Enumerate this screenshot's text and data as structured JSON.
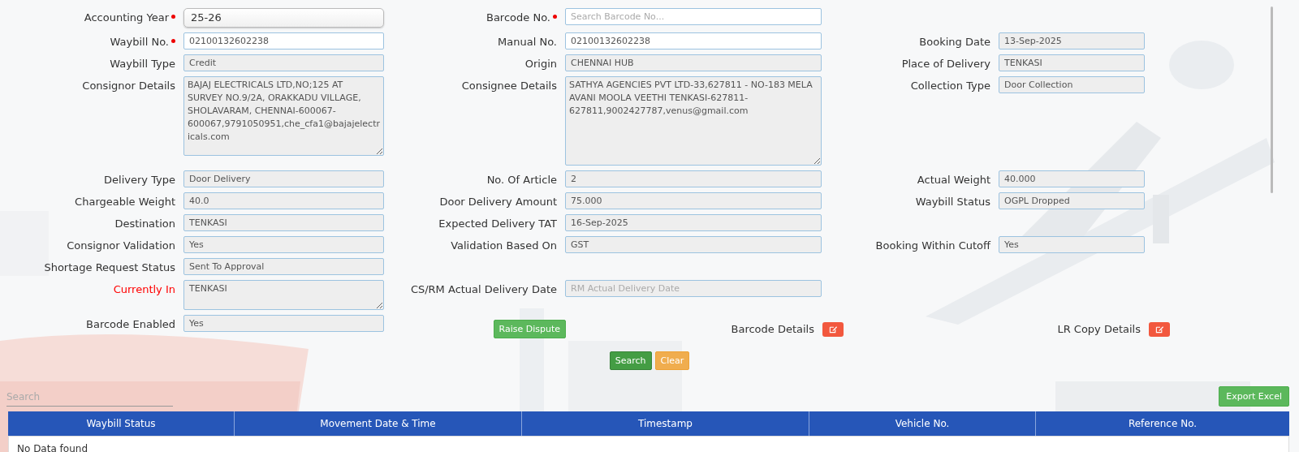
{
  "form_rows": [
    {
      "left": {
        "label": "Accounting Year",
        "required": true,
        "kind": "select",
        "value": "25-26"
      },
      "middle": {
        "label": "Barcode No.",
        "required": true,
        "kind": "input",
        "placeholder": "Search Barcode No..."
      }
    },
    {
      "left": {
        "label": "Waybill No.",
        "required": true,
        "kind": "input",
        "value": "02100132602238"
      },
      "middle": {
        "label": "Manual No.",
        "kind": "input",
        "value": "02100132602238"
      },
      "right": {
        "label": "Booking Date",
        "kind": "readonly",
        "value": "13-Sep-2025"
      }
    },
    {
      "left": {
        "label": "Waybill Type",
        "kind": "readonly",
        "value": "Credit"
      },
      "middle": {
        "label": "Origin",
        "kind": "readonly",
        "value": "CHENNAI HUB"
      },
      "right": {
        "label": "Place of Delivery",
        "kind": "readonly",
        "value": "TENKASI"
      }
    },
    {
      "left": {
        "label": "Consignor Details",
        "kind": "textarea",
        "value": "BAJAJ ELECTRICALS LTD,NO;125 AT SURVEY NO.9/2A, ORAKKADU VILLAGE, SHOLAVARAM, CHENNAI-600067-600067,9791050951,che_cfa1@bajajelectricals.com"
      },
      "middle": {
        "label": "Consignee Details",
        "kind": "textarea",
        "value": "SATHYA AGENCIES PVT LTD-33,627811 - NO-183 MELA AVANI MOOLA VEETHI TENKASI-627811-627811,9002427787,venus@gmail.com"
      },
      "right": {
        "label": "Collection Type",
        "kind": "readonly",
        "value": "Door Collection"
      }
    },
    {
      "left": {
        "label": "Delivery Type",
        "kind": "readonly",
        "value": "Door Delivery"
      },
      "middle": {
        "label": "No. Of Article",
        "kind": "readonly",
        "value": "2"
      },
      "right": {
        "label": "Actual Weight",
        "kind": "readonly",
        "value": "40.000"
      }
    },
    {
      "left": {
        "label": "Chargeable Weight",
        "kind": "readonly",
        "value": "40.0"
      },
      "middle": {
        "label": "Door Delivery Amount",
        "kind": "readonly",
        "value": "75.000"
      },
      "right": {
        "label": "Waybill Status",
        "kind": "readonly",
        "value": "OGPL Dropped"
      }
    },
    {
      "left": {
        "label": "Destination",
        "kind": "readonly",
        "value": "TENKASI"
      },
      "middle": {
        "label": "Expected Delivery TAT",
        "kind": "readonly",
        "value": "16-Sep-2025"
      }
    },
    {
      "left": {
        "label": "Consignor Validation",
        "kind": "readonly",
        "value": "Yes"
      },
      "middle": {
        "label": "Validation Based On",
        "kind": "readonly",
        "value": "GST"
      },
      "right": {
        "label": "Booking Within Cutoff",
        "kind": "readonly",
        "value": "Yes"
      }
    },
    {
      "left": {
        "label": "Shortage Request Status",
        "kind": "readonly",
        "value": "Sent To Approval"
      }
    },
    {
      "left": {
        "label": "Currently In",
        "alert": true,
        "kind": "smallarea",
        "value": "TENKASI"
      },
      "middle": {
        "label": "CS/RM Actual Delivery Date",
        "kind": "readonly",
        "placeholder": "RM Actual Delivery Date"
      }
    },
    {
      "left": {
        "label": "Barcode Enabled",
        "kind": "readonly",
        "value": "Yes"
      },
      "extras": [
        {
          "kind": "button",
          "label": "Raise Dispute"
        },
        {
          "kind": "edit",
          "label": "Barcode Details"
        },
        {
          "kind": "edit",
          "label": "LR Copy Details"
        }
      ]
    }
  ],
  "actions": [
    {
      "label": "Search",
      "kind": "primary"
    },
    {
      "label": "Clear",
      "kind": "warning"
    }
  ],
  "search": {
    "placeholder": "Search"
  },
  "export_button": "Export Excel",
  "table": {
    "columns": [
      "Waybill Status",
      "Movement Date & Time",
      "Timestamp",
      "Vehicle No.",
      "Reference No."
    ],
    "empty_message": "No Data found"
  }
}
